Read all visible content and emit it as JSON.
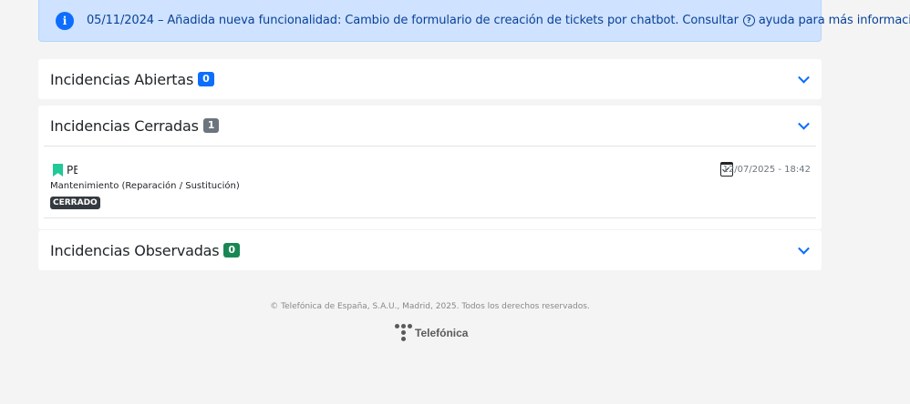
{
  "notice": {
    "text_before": "05/11/2024 – Añadida nueva funcionalidad: Cambio de formulario de creación de tickets por chatbot. Consultar",
    "help_icon_glyph": "?",
    "text_after": "ayuda para más información.",
    "icon": "info-icon",
    "icon_glyph": "i"
  },
  "sections": {
    "open": {
      "title": "Incidencias Abiertas",
      "count": "0",
      "badge_color": "#0d6efd"
    },
    "closed": {
      "title": "Incidencias Cerradas",
      "count": "1",
      "badge_color": "#6c757d"
    },
    "observed": {
      "title": "Incidencias Observadas",
      "count": "0",
      "badge_color": "#198754"
    }
  },
  "closed_tickets": [
    {
      "code": "PE",
      "type": "Mantenimiento (Reparación / Sustitución)",
      "status": "CERRADO",
      "date": "12/07/2025 - 18:42",
      "icon": "bookmark-icon"
    }
  ],
  "footer": {
    "copyright": "© Telefónica de España, S.A.U., Madrid, 2025. Todos los derechos reservados.",
    "brand": "Telefónica"
  },
  "colors": {
    "page_background": "#f4f4f4",
    "notice_background": "#cfe2ff",
    "accent": "#0d6efd",
    "bookmark": "#20c997"
  }
}
